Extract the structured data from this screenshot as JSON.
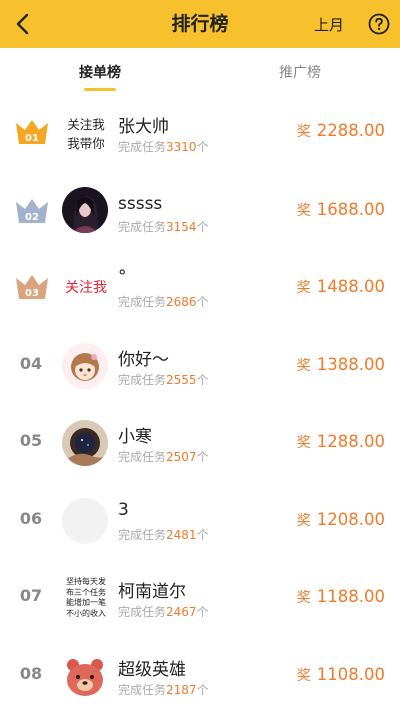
{
  "header": {
    "title": "排行榜",
    "month_label": "上月"
  },
  "tabs": [
    {
      "label": "接单榜",
      "active": true
    },
    {
      "label": "推广榜",
      "active": false
    }
  ],
  "colors": {
    "brand_yellow": "#f7c12e",
    "accent_orange": "#f07b2a",
    "red_text": "#e0283a"
  },
  "rows": [
    {
      "rank": "01",
      "name": "张大帅",
      "tasks_label": "完成任务",
      "tasks_count": "3310",
      "tasks_unit": "个",
      "reward_label": "奖",
      "reward": "2288.00",
      "avatar_text": [
        "关注我",
        "我带你"
      ]
    },
    {
      "rank": "02",
      "name": "sssss",
      "tasks_label": "完成任务",
      "tasks_count": "3154",
      "tasks_unit": "个",
      "reward_label": "奖",
      "reward": "1688.00"
    },
    {
      "rank": "03",
      "name": "°",
      "tasks_label": "完成任务",
      "tasks_count": "2686",
      "tasks_unit": "个",
      "reward_label": "奖",
      "reward": "1488.00",
      "avatar_text": [
        "关注我"
      ]
    },
    {
      "rank": "04",
      "name": "你好～",
      "tasks_label": "完成任务",
      "tasks_count": "2555",
      "tasks_unit": "个",
      "reward_label": "奖",
      "reward": "1388.00"
    },
    {
      "rank": "05",
      "name": "小寒",
      "tasks_label": "完成任务",
      "tasks_count": "2507",
      "tasks_unit": "个",
      "reward_label": "奖",
      "reward": "1288.00"
    },
    {
      "rank": "06",
      "name": "3",
      "tasks_label": "完成任务",
      "tasks_count": "2481",
      "tasks_unit": "个",
      "reward_label": "奖",
      "reward": "1208.00"
    },
    {
      "rank": "07",
      "name": "柯南道尔",
      "tasks_label": "完成任务",
      "tasks_count": "2467",
      "tasks_unit": "个",
      "reward_label": "奖",
      "reward": "1188.00",
      "avatar_text": [
        "坚持每天发",
        "布三个任务",
        "能增加一笔",
        "不小的收入"
      ]
    },
    {
      "rank": "08",
      "name": "超级英雄",
      "tasks_label": "完成任务",
      "tasks_count": "2187",
      "tasks_unit": "个",
      "reward_label": "奖",
      "reward": "1108.00"
    }
  ]
}
